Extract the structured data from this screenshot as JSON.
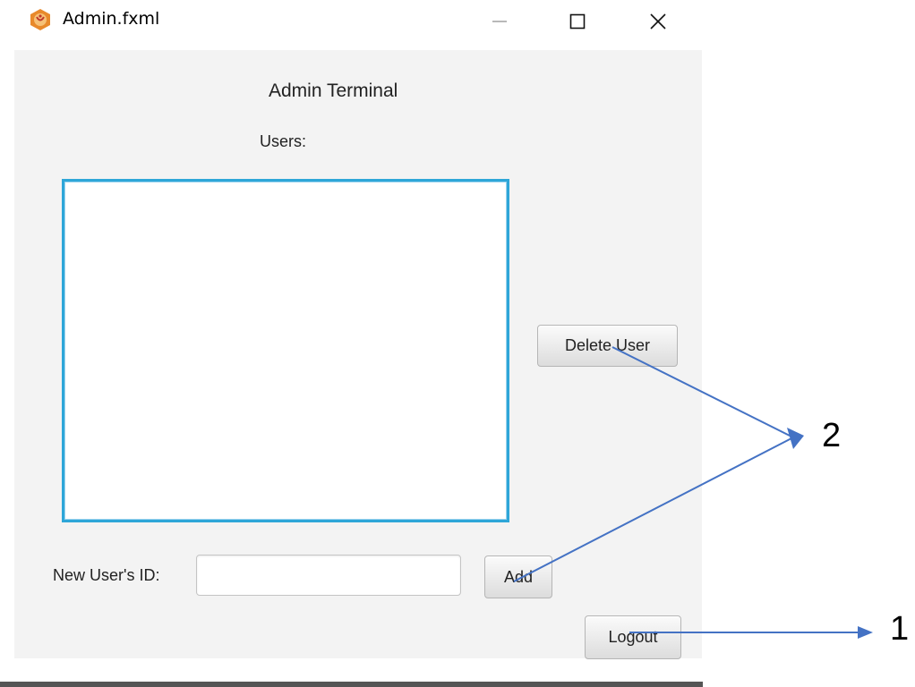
{
  "window": {
    "title": "Admin.fxml",
    "minimize_icon": "minimize-icon",
    "maximize_icon": "maximize-icon",
    "close_icon": "close-icon",
    "app_icon": "java-app-icon"
  },
  "admin": {
    "heading": "Admin Terminal",
    "users_label": "Users:",
    "users": [],
    "delete_button": "Delete User",
    "new_id_label": "New User's ID:",
    "new_id_value": "",
    "add_button": "Add",
    "logout_button": "Logout"
  },
  "annotations": {
    "callout_1": "1",
    "callout_2": "2",
    "arrow_color": "#4472c4"
  },
  "colors": {
    "list_border": "#2ea6d8",
    "panel_background": "#f3f3f3"
  }
}
